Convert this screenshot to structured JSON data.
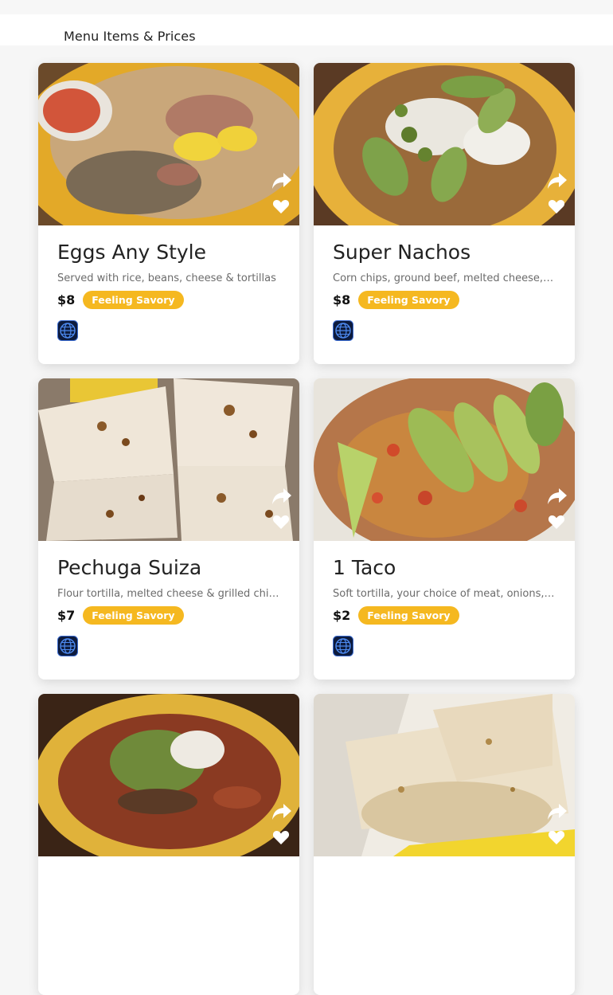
{
  "header": {
    "title": "Menu Items & Prices"
  },
  "cards": [
    {
      "name": "Eggs Any Style",
      "description": "Served with rice, beans, cheese & tortillas",
      "price": "$8",
      "badge": "Feeling Savory"
    },
    {
      "name": "Super Nachos",
      "description": "Corn chips, ground beef, melted cheese, sour cream & jalapeños",
      "price": "$8",
      "badge": "Feeling Savory"
    },
    {
      "name": "Pechuga Suiza",
      "description": "Flour tortilla, melted cheese & grilled chicken",
      "price": "$7",
      "badge": "Feeling Savory"
    },
    {
      "name": "1 Taco",
      "description": "Soft tortilla, your choice of meat, onions, cilantro",
      "price": "$2",
      "badge": "Feeling Savory"
    },
    {
      "name": "",
      "description": "",
      "price": "",
      "badge": ""
    },
    {
      "name": "",
      "description": "",
      "price": "",
      "badge": ""
    }
  ],
  "colors": {
    "badge": "#f5b820",
    "card": "#ffffff",
    "background": "#f6f6f6"
  },
  "icons": {
    "share": "share-icon",
    "favorite": "heart-icon",
    "website": "globe-icon"
  }
}
